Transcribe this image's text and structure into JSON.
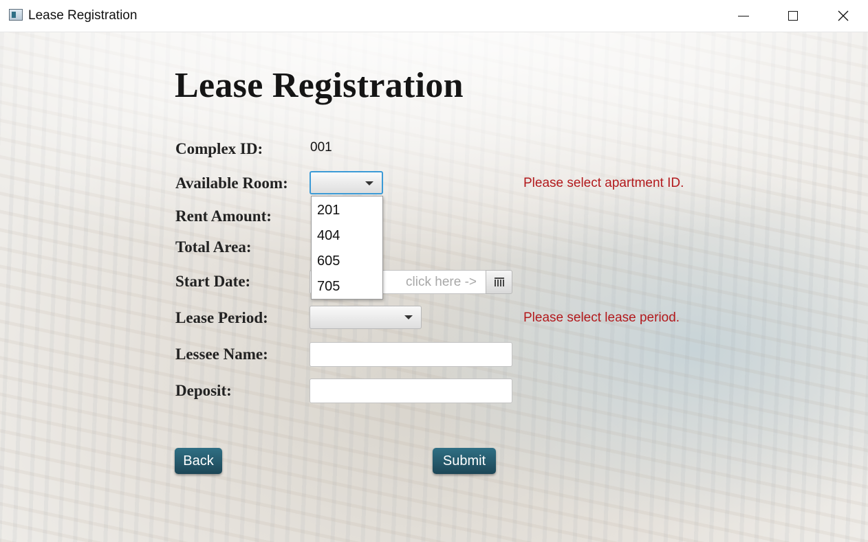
{
  "window": {
    "title": "Lease Registration",
    "controls": {
      "minimize": "minimize",
      "maximize": "maximize",
      "close": "close"
    }
  },
  "page": {
    "heading": "Lease Registration"
  },
  "form": {
    "complex_id": {
      "label": "Complex ID:",
      "value": "001"
    },
    "available_room": {
      "label": "Available Room:",
      "selected": "",
      "options": [
        "201",
        "404",
        "605",
        "705"
      ],
      "error": "Please select apartment ID."
    },
    "rent_amount": {
      "label": "Rent Amount:"
    },
    "total_area": {
      "label": "Total Area:"
    },
    "start_date": {
      "label": "Start Date:",
      "placeholder": "click here ->",
      "button_icon": "calendar-icon"
    },
    "lease_period": {
      "label": "Lease Period:",
      "selected": "",
      "error": "Please select lease period."
    },
    "lessee_name": {
      "label": "Lessee Name:",
      "value": ""
    },
    "deposit": {
      "label": "Deposit:",
      "value": ""
    }
  },
  "buttons": {
    "back": "Back",
    "submit": "Submit"
  },
  "colors": {
    "error": "#b2191c",
    "button": "#1f4e5f",
    "focus": "#3b9ad6"
  }
}
